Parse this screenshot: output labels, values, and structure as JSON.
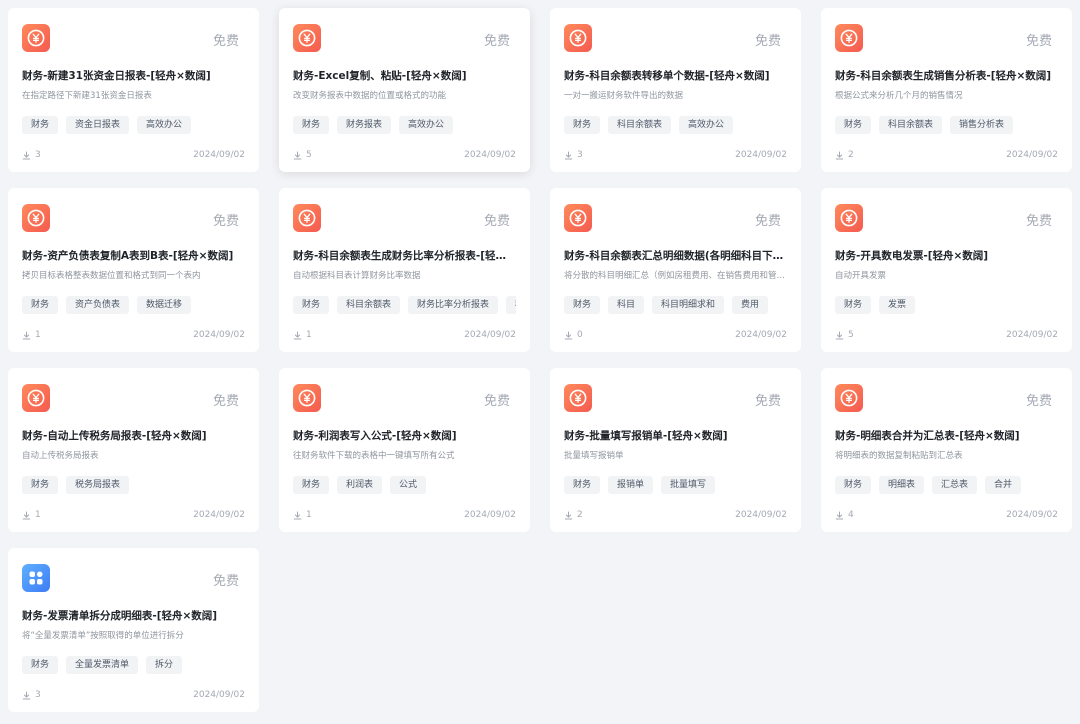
{
  "colors": {
    "background": "#f3f4f7",
    "card": "#ffffff",
    "icon_orange": "#f45a4f",
    "icon_blue": "#3d7cf5",
    "tag_bg": "#f2f3f5"
  },
  "cards": [
    {
      "icon": "yen-icon",
      "price": "免费",
      "title": "财务-新建31张资金日报表-[轻舟×数阔]",
      "desc": "在指定路径下新建31张资金日报表",
      "tags": [
        "财务",
        "资金日报表",
        "高效办公"
      ],
      "downloads": "3",
      "date": "2024/09/02"
    },
    {
      "icon": "yen-icon",
      "price": "免费",
      "title": "财务-Excel复制、粘贴-[轻舟×数阔]",
      "desc": "改变财务报表中数据的位置或格式的功能",
      "tags": [
        "财务",
        "财务报表",
        "高效办公"
      ],
      "downloads": "5",
      "date": "2024/09/02",
      "hovered": true
    },
    {
      "icon": "yen-icon",
      "price": "免费",
      "title": "财务-科目余额表转移单个数据-[轻舟×数阔]",
      "desc": "一对一搬运财务软件导出的数据",
      "tags": [
        "财务",
        "科目余额表",
        "高效办公"
      ],
      "downloads": "3",
      "date": "2024/09/02"
    },
    {
      "icon": "yen-icon",
      "price": "免费",
      "title": "财务-科目余额表生成销售分析表-[轻舟×数阔]",
      "desc": "根据公式来分析几个月的销售情况",
      "tags": [
        "财务",
        "科目余额表",
        "销售分析表"
      ],
      "downloads": "2",
      "date": "2024/09/02"
    },
    {
      "icon": "yen-icon",
      "price": "免费",
      "title": "财务-资产负债表复制A表到B表-[轻舟×数阔]",
      "desc": "拷贝目标表格整表数据位置和格式到同一个表内",
      "tags": [
        "财务",
        "资产负债表",
        "数据迁移"
      ],
      "downloads": "1",
      "date": "2024/09/02"
    },
    {
      "icon": "yen-icon",
      "price": "免费",
      "title": "财务-科目余额表生成财务比率分析报表-[轻舟×数阔]",
      "desc": "自动根据科目表计算财务比率数据",
      "tags": [
        "财务",
        "科目余额表",
        "财务比率分析报表",
        "科目"
      ],
      "downloads": "1",
      "date": "2024/09/02"
    },
    {
      "icon": "yen-icon",
      "price": "免费",
      "title": "财务-科目余额表汇总明细数据(各明细科目下房屋费用)-[轻舟×数阔]",
      "desc": "将分散的科目明细汇总（例如房租费用、在销售费用和管理费用中）",
      "tags": [
        "财务",
        "科目",
        "科目明细求和",
        "费用"
      ],
      "downloads": "0",
      "date": "2024/09/02"
    },
    {
      "icon": "yen-icon",
      "price": "免费",
      "title": "财务-开具数电发票-[轻舟×数阔]",
      "desc": "自动开具发票",
      "tags": [
        "财务",
        "发票"
      ],
      "downloads": "5",
      "date": "2024/09/02"
    },
    {
      "icon": "yen-icon",
      "price": "免费",
      "title": "财务-自动上传税务局报表-[轻舟×数阔]",
      "desc": "自动上传税务局报表",
      "tags": [
        "财务",
        "税务局报表"
      ],
      "downloads": "1",
      "date": "2024/09/02"
    },
    {
      "icon": "yen-icon",
      "price": "免费",
      "title": "财务-利润表写入公式-[轻舟×数阔]",
      "desc": "往财务软件下载的表格中一键填写所有公式",
      "tags": [
        "财务",
        "利润表",
        "公式"
      ],
      "downloads": "1",
      "date": "2024/09/02"
    },
    {
      "icon": "yen-icon",
      "price": "免费",
      "title": "财务-批量填写报销单-[轻舟×数阔]",
      "desc": "批量填写报销单",
      "tags": [
        "财务",
        "报销单",
        "批量填写"
      ],
      "downloads": "2",
      "date": "2024/09/02"
    },
    {
      "icon": "yen-icon",
      "price": "免费",
      "title": "财务-明细表合并为汇总表-[轻舟×数阔]",
      "desc": "将明细表的数据复制粘贴到汇总表",
      "tags": [
        "财务",
        "明细表",
        "汇总表",
        "合并"
      ],
      "downloads": "4",
      "date": "2024/09/02"
    },
    {
      "icon": "app-grid-icon",
      "price": "免费",
      "title": "财务-发票清单拆分成明细表-[轻舟×数阔]",
      "desc": "将“全量发票清单”按照取得的单位进行拆分",
      "tags": [
        "财务",
        "全量发票清单",
        "拆分"
      ],
      "downloads": "3",
      "date": "2024/09/02"
    }
  ]
}
